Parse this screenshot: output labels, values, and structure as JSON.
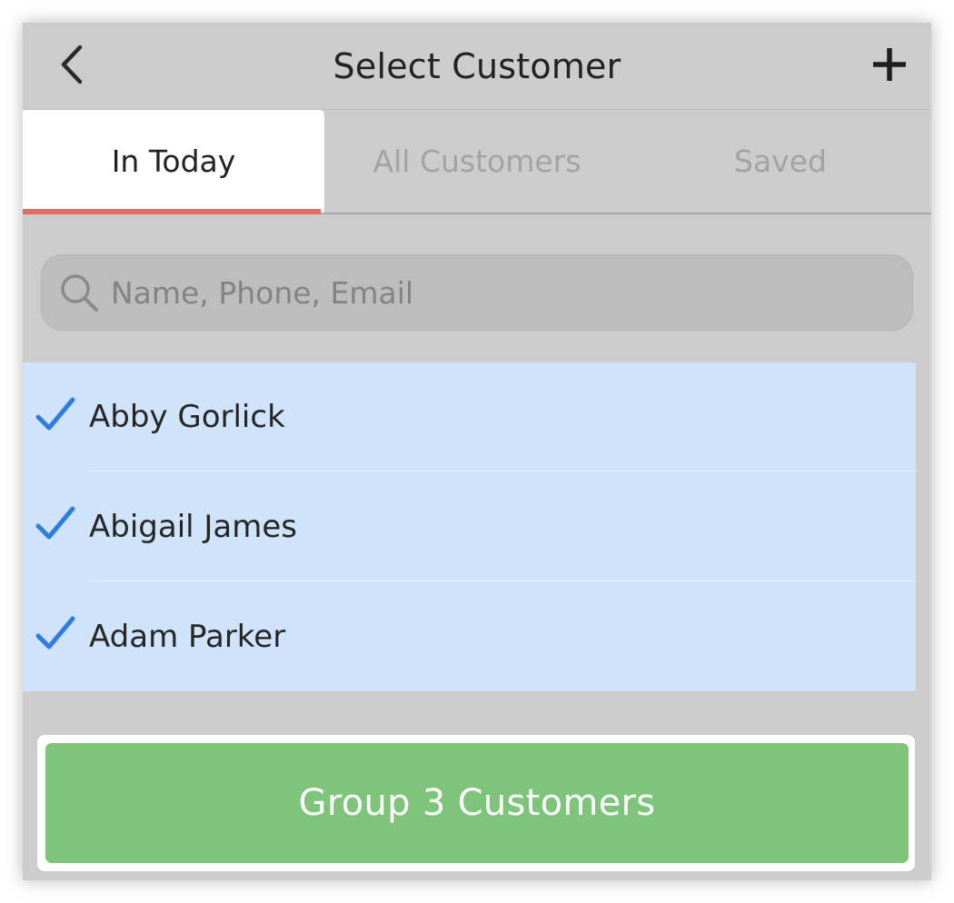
{
  "header": {
    "title": "Select Customer",
    "back_icon": "chevron-left-icon",
    "add_icon": "plus-icon"
  },
  "tabs": [
    {
      "label": "In Today",
      "active": true
    },
    {
      "label": "All Customers",
      "active": false
    },
    {
      "label": "Saved",
      "active": false
    }
  ],
  "search": {
    "placeholder": "Name, Phone, Email",
    "value": ""
  },
  "customers": [
    {
      "name": "Abby Gorlick",
      "selected": true
    },
    {
      "name": "Abigail James",
      "selected": true
    },
    {
      "name": "Adam Parker",
      "selected": true
    }
  ],
  "footer": {
    "group_button_label": "Group 3 Customers"
  },
  "colors": {
    "background": "#cccccc",
    "active_tab_indicator": "#de6b64",
    "selected_row": "#cfe3fb",
    "check": "#2f7ddc",
    "group_button": "#7ec47a"
  }
}
